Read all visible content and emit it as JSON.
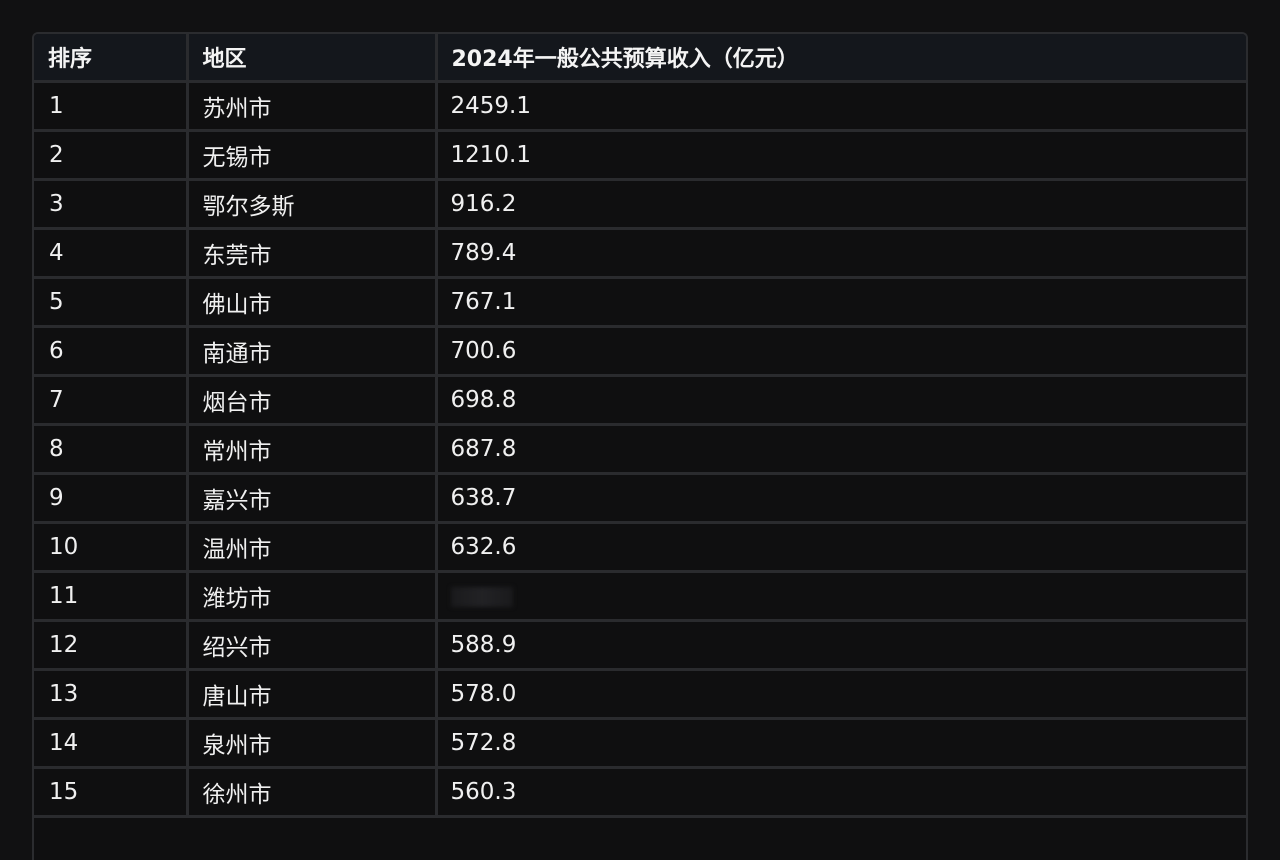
{
  "table": {
    "headers": [
      "排序",
      "地区",
      "2024年一般公共预算收入（亿元）"
    ],
    "rows": [
      {
        "rank": "1",
        "region": "苏州市",
        "value": "2459.1"
      },
      {
        "rank": "2",
        "region": "无锡市",
        "value": "1210.1"
      },
      {
        "rank": "3",
        "region": "鄂尔多斯",
        "value": "916.2"
      },
      {
        "rank": "4",
        "region": "东莞市",
        "value": "789.4"
      },
      {
        "rank": "5",
        "region": "佛山市",
        "value": "767.1"
      },
      {
        "rank": "6",
        "region": "南通市",
        "value": "700.6"
      },
      {
        "rank": "7",
        "region": "烟台市",
        "value": "698.8"
      },
      {
        "rank": "8",
        "region": "常州市",
        "value": "687.8"
      },
      {
        "rank": "9",
        "region": "嘉兴市",
        "value": "638.7"
      },
      {
        "rank": "10",
        "region": "温州市",
        "value": "632.6"
      },
      {
        "rank": "11",
        "region": "潍坊市",
        "value": null,
        "obscured": true
      },
      {
        "rank": "12",
        "region": "绍兴市",
        "value": "588.9"
      },
      {
        "rank": "13",
        "region": "唐山市",
        "value": "578.0"
      },
      {
        "rank": "14",
        "region": "泉州市",
        "value": "572.8"
      },
      {
        "rank": "15",
        "region": "徐州市",
        "value": "560.3"
      }
    ]
  }
}
